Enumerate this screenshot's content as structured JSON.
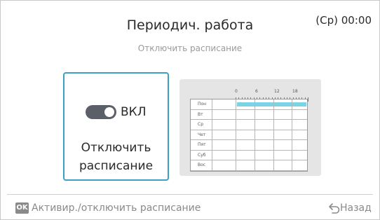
{
  "header": {
    "title": "Периодич. работа",
    "subtitle": "Отключить расписание",
    "clock": "(Ср) 00:00"
  },
  "card": {
    "toggle_state": "ВКЛ",
    "toggle_on": true,
    "label": "Отключить расписание"
  },
  "schedule": {
    "hour_marks": [
      "0",
      "6",
      "12",
      "18"
    ],
    "days": [
      "Пон",
      "Вт",
      "Ср",
      "Чет",
      "Пят",
      "Суб",
      "Вос"
    ],
    "active_day": "Пон",
    "active_color": "#7cd3e6"
  },
  "footer": {
    "ok_badge": "OK",
    "hint": "Активир./отключить расписание",
    "back_icon": "back-arrow-icon",
    "back_label": "Назад"
  },
  "colors": {
    "accent": "#3aa0c8",
    "toggle_bg": "#5b6068"
  }
}
